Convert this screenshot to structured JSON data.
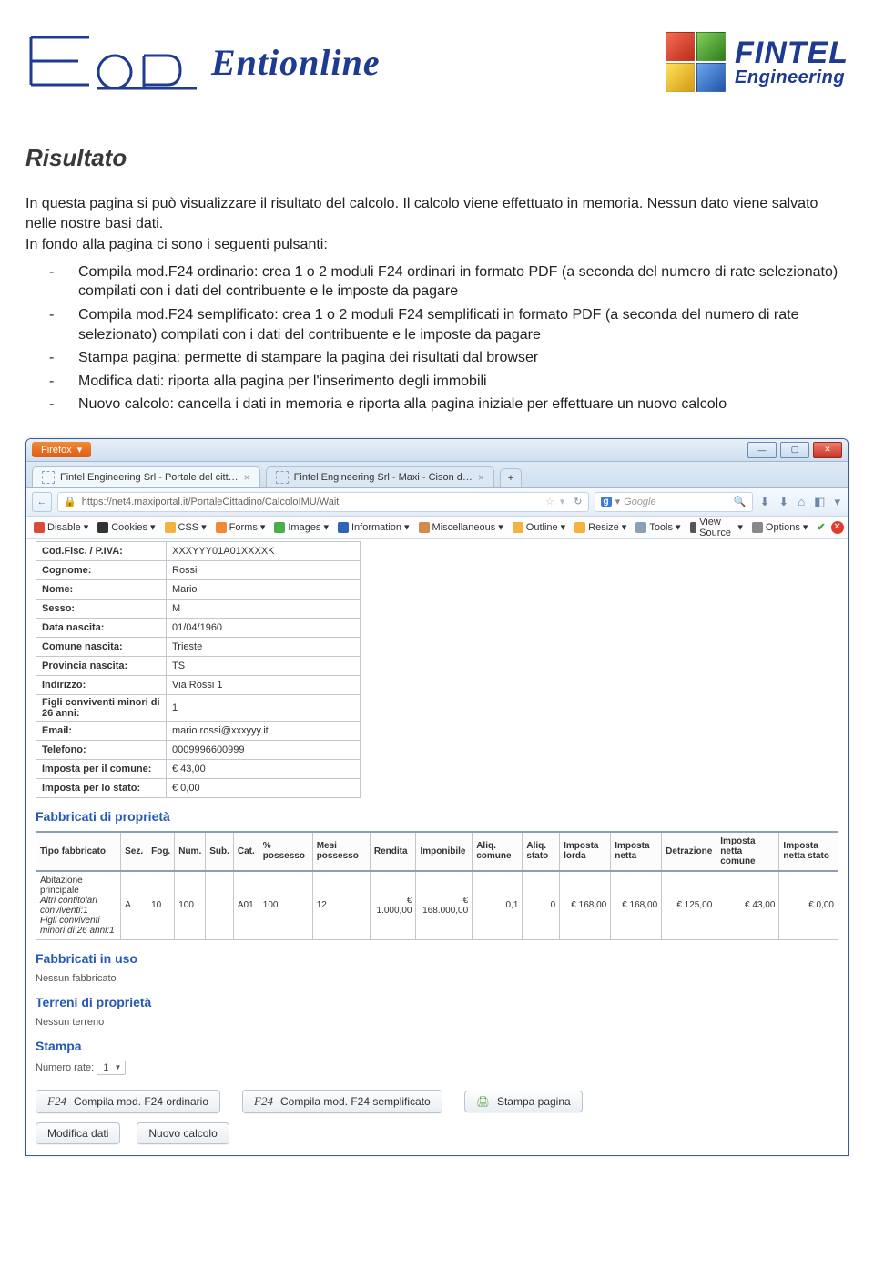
{
  "header": {
    "logo1_text": "Entionline",
    "fintel_line1": "FINTEL",
    "fintel_line2": "Engineering"
  },
  "doc": {
    "title": "Risultato",
    "para1": "In questa pagina si può visualizzare il risultato del calcolo. Il calcolo viene effettuato in memoria. Nessun dato viene salvato nelle nostre basi dati.",
    "para2": "In fondo alla pagina ci sono i seguenti pulsanti:",
    "bullets": [
      "Compila mod.F24 ordinario: crea 1 o 2 moduli F24 ordinari in formato PDF (a seconda del numero di rate selezionato) compilati con i dati del contribuente e le imposte da pagare",
      "Compila mod.F24 semplificato: crea 1 o 2 moduli F24 semplificati in formato PDF (a seconda del numero di rate selezionato) compilati con i dati del contribuente e le imposte da pagare",
      "Stampa pagina: permette di stampare la pagina dei risultati dal browser",
      "Modifica dati: riporta alla pagina per l'inserimento degli immobili",
      "Nuovo calcolo: cancella i dati in memoria e riporta alla pagina iniziale per effettuare un nuovo calcolo"
    ]
  },
  "browser": {
    "firefox_label": "Firefox",
    "tabs": [
      "Fintel Engineering Srl - Portale del citt…",
      "Fintel Engineering Srl - Maxi - Cison d…"
    ],
    "url": "https://net4.maxiportal.it/PortaleCittadino/CalcoloIMU/Wait",
    "search_provider_badge": "g",
    "search_placeholder": "Google",
    "devtools": [
      "Disable",
      "Cookies",
      "CSS",
      "Forms",
      "Images",
      "Information",
      "Miscellaneous",
      "Outline",
      "Resize",
      "Tools",
      "View Source",
      "Options"
    ]
  },
  "taxpayer": {
    "rows": [
      {
        "k": "Cod.Fisc. / P.IVA:",
        "v": "XXXYYY01A01XXXXK"
      },
      {
        "k": "Cognome:",
        "v": "Rossi"
      },
      {
        "k": "Nome:",
        "v": "Mario"
      },
      {
        "k": "Sesso:",
        "v": "M"
      },
      {
        "k": "Data nascita:",
        "v": "01/04/1960"
      },
      {
        "k": "Comune nascita:",
        "v": "Trieste"
      },
      {
        "k": "Provincia nascita:",
        "v": "TS"
      },
      {
        "k": "Indirizzo:",
        "v": "Via Rossi 1"
      },
      {
        "k": "Figli conviventi minori di 26 anni:",
        "v": "1"
      },
      {
        "k": "Email:",
        "v": "mario.rossi@xxxyyy.it"
      },
      {
        "k": "Telefono:",
        "v": "0009996600999"
      },
      {
        "k": "Imposta per il comune:",
        "v": "€ 43,00"
      },
      {
        "k": "Imposta per lo stato:",
        "v": "€ 0,00"
      }
    ]
  },
  "sections": {
    "fabbricati_prop": "Fabbricati di proprietà",
    "fabbricati_uso": "Fabbricati in uso",
    "fabbricati_uso_empty": "Nessun fabbricato",
    "terreni_prop": "Terreni di proprietà",
    "terreni_empty": "Nessun terreno",
    "stampa": "Stampa",
    "numero_rate_label": "Numero rate:",
    "numero_rate_value": "1"
  },
  "fab_table": {
    "headers": [
      "Tipo fabbricato",
      "Sez.",
      "Fog.",
      "Num.",
      "Sub.",
      "Cat.",
      "% possesso",
      "Mesi possesso",
      "Rendita",
      "Imponibile",
      "Aliq. comune",
      "Aliq. stato",
      "Imposta lorda",
      "Imposta netta",
      "Detrazione",
      "Imposta netta comune",
      "Imposta netta stato"
    ],
    "row": {
      "tipo_line1": "Abitazione principale",
      "tipo_line2": "Altri contitolari conviventi:1",
      "tipo_line3": "Figli conviventi minori di 26 anni:1",
      "sez": "A",
      "fog": "10",
      "num": "100",
      "sub": "",
      "cat": "A01",
      "perc": "100",
      "mesi": "12",
      "rendita": "€ 1.000,00",
      "imponibile": "€ 168.000,00",
      "aliq_com": "0,1",
      "aliq_stato": "0",
      "imp_lorda": "€ 168,00",
      "imp_netta": "€ 168,00",
      "detraz": "€ 125,00",
      "imp_netta_com": "€ 43,00",
      "imp_netta_stato": "€ 0,00"
    }
  },
  "buttons": {
    "f24_prefix": "F24",
    "b1": "Compila mod. F24 ordinario",
    "b2": "Compila mod. F24 semplificato",
    "b3": "Stampa pagina",
    "b4": "Modifica dati",
    "b5": "Nuovo calcolo"
  }
}
